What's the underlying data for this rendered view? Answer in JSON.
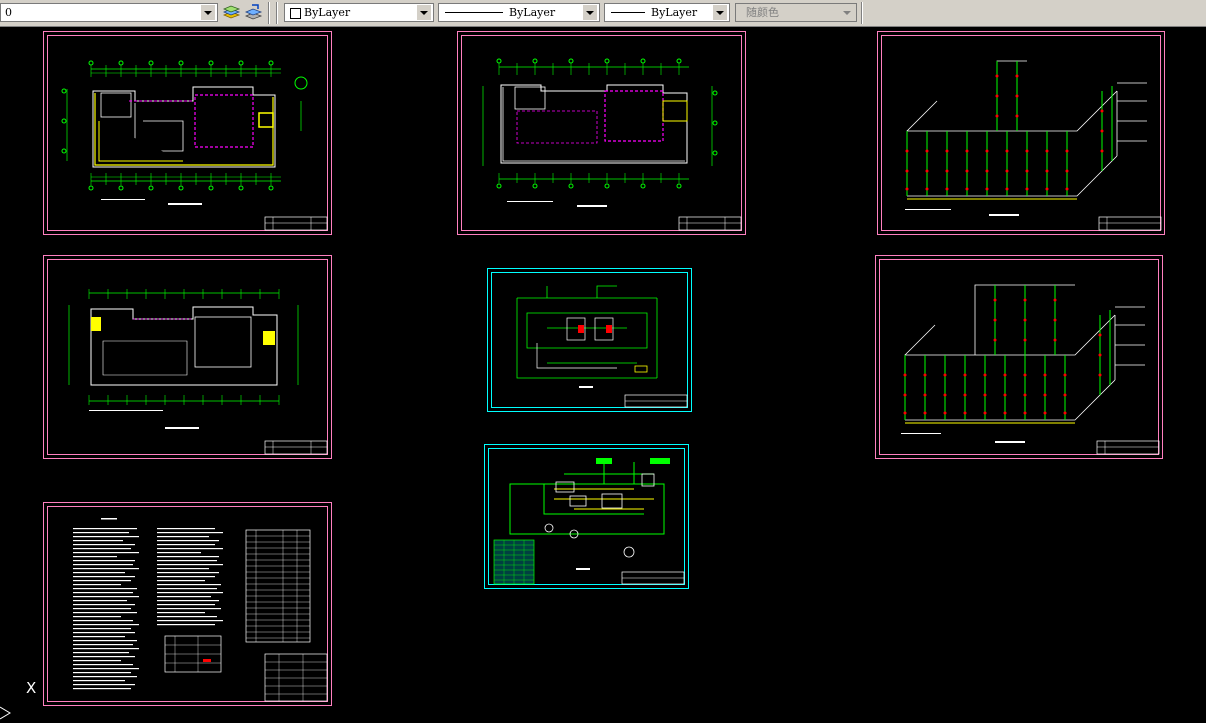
{
  "toolbar": {
    "layer_value": "0",
    "color_value": "ByLayer",
    "linetype_value": "ByLayer",
    "lineweight_value": "ByLayer",
    "plotstyle_value": "随颜色"
  },
  "colors": {
    "sheet_border_red": "#ff80c0",
    "sheet_border_cyan": "#00ffff",
    "plan_line": "#00ff00",
    "pipe_magenta": "#ff00ff",
    "accent_yellow": "#ffff00",
    "text_white": "#ffffff",
    "valve_red": "#ff0000"
  },
  "icons": [
    "layer-manager-icon",
    "layer-previous-icon",
    "color-swatch-icon",
    "ucs-icon"
  ],
  "ucs": {
    "label": "X"
  }
}
